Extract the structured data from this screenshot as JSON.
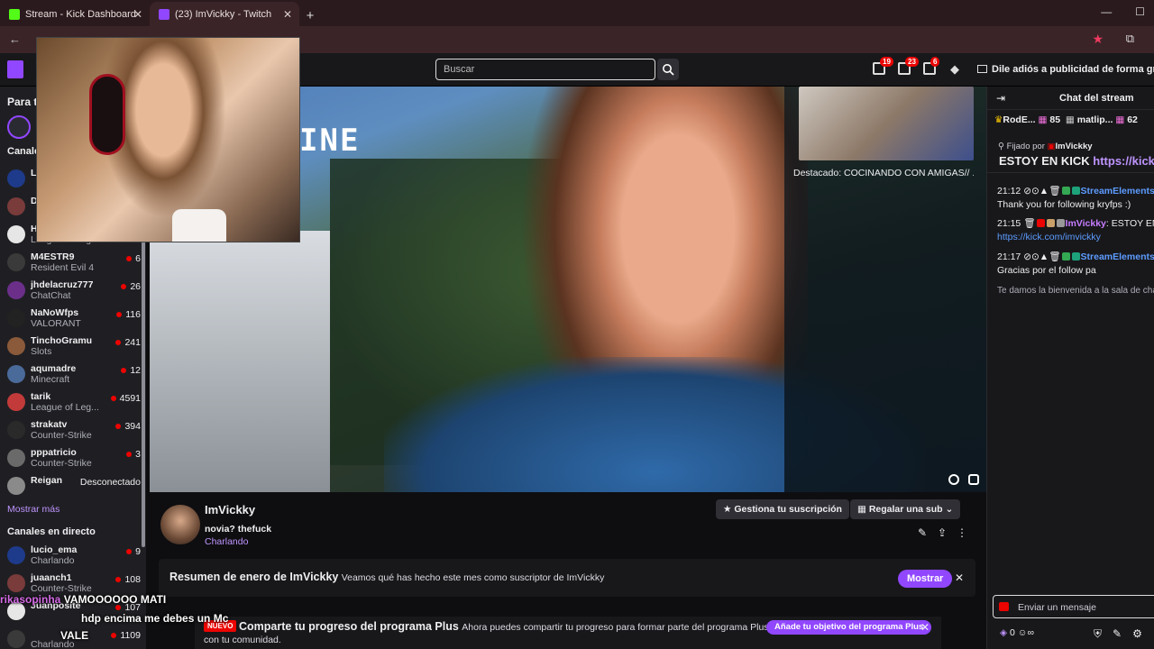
{
  "browser": {
    "tabs": [
      {
        "label": "Stream - Kick Dashboard",
        "color": "#53fc18"
      },
      {
        "label": "(23) ImVickky - Twitch",
        "color": "#9147ff"
      }
    ],
    "new_tab": "+",
    "close": "✕"
  },
  "topnav": {
    "search_placeholder": "Buscar",
    "badges": [
      "19",
      "23",
      "6"
    ],
    "adfree": "Dile adiós a publicidad de forma gratuita"
  },
  "sidebar": {
    "for_you": "Para t",
    "followed_heading": "Canales",
    "followed": [
      {
        "name": "L",
        "game": "",
        "viewers": ""
      },
      {
        "name": "D",
        "game": "",
        "viewers": ""
      },
      {
        "name": "H",
        "game": "League of Legen...",
        "viewers": ""
      },
      {
        "name": "M4ESTR9",
        "game": "Resident Evil 4",
        "viewers": "6"
      },
      {
        "name": "jhdelacruz777",
        "game": "ChatChat",
        "viewers": "26"
      },
      {
        "name": "NaNoWfps",
        "game": "VALORANT",
        "viewers": "116"
      },
      {
        "name": "TinchoGramu",
        "game": "Slots",
        "viewers": "241"
      },
      {
        "name": "aqumadre",
        "game": "Minecraft",
        "viewers": "12"
      },
      {
        "name": "tarik",
        "game": "League of Leg...",
        "viewers": "4591"
      },
      {
        "name": "strakatv",
        "game": "Counter-Strike",
        "viewers": "394"
      },
      {
        "name": "pppatricio",
        "game": "Counter-Strike",
        "viewers": "3"
      },
      {
        "name": "Reigan",
        "game": "",
        "viewers": "Desconectado"
      }
    ],
    "show_more": "Mostrar más",
    "live_heading": "Canales en directo",
    "live": [
      {
        "name": "lucio_ema",
        "game": "Charlando",
        "viewers": "9"
      },
      {
        "name": "juaanch1",
        "game": "Counter-Strike",
        "viewers": "108"
      },
      {
        "name": "Juanposite",
        "game": "",
        "viewers": "107"
      },
      {
        "name": "",
        "game": "Charlando",
        "viewers": "1109"
      }
    ]
  },
  "video": {
    "sign_text": "INE",
    "featured": "Destacado: COCINANDO CON AMIGAS// ..."
  },
  "overlay_chat": [
    {
      "user": "rikasopinha",
      "text": "VAMOOOOOO MATI"
    },
    {
      "user": "",
      "text": "hdp encima me debes un Mc"
    },
    {
      "user": "",
      "text": "VALE"
    }
  ],
  "channel": {
    "name": "ImVickky",
    "title": "novia? thefuck",
    "category": "Charlando",
    "manage_sub": "Gestiona tu suscripción",
    "gift_sub": "Regalar una sub"
  },
  "banner": {
    "title": "Resumen de enero de ImVickky",
    "text": "Veamos qué has hecho este mes como suscriptor de ImVickky",
    "button": "Mostrar"
  },
  "banner2": {
    "new": "NUEVO",
    "title": "Comparte tu progreso del programa Plus",
    "text": "Ahora puedes compartir tu progreso para formar parte del programa Plus",
    "text2": "con tu comunidad.",
    "button": "Añade tu objetivo del programa Plus"
  },
  "chat": {
    "header": "Chat del stream",
    "gifts": [
      {
        "name": "RodE...",
        "count": "85"
      },
      {
        "name": "matlip...",
        "count": "62"
      }
    ],
    "pinned_by_label": "Fijado por",
    "pinned_by": "ImVickky",
    "pinned_text": "ESTOY EN KICK",
    "pinned_link": "https://kick...",
    "messages": [
      {
        "time": "21:12",
        "user": "StreamElements",
        "text": "Thank you for following kryfps :)"
      },
      {
        "time": "21:15",
        "user": "ImVickky",
        "text": "ESTOY EN",
        "link": "https://kick.com/imvickky"
      },
      {
        "time": "21:17",
        "user": "StreamElements",
        "text": "Gracias por el follow pa"
      }
    ],
    "welcome": "Te damos la bienvenida a la sala de chat",
    "input_placeholder": "Enviar un mensaje",
    "points": "0"
  }
}
